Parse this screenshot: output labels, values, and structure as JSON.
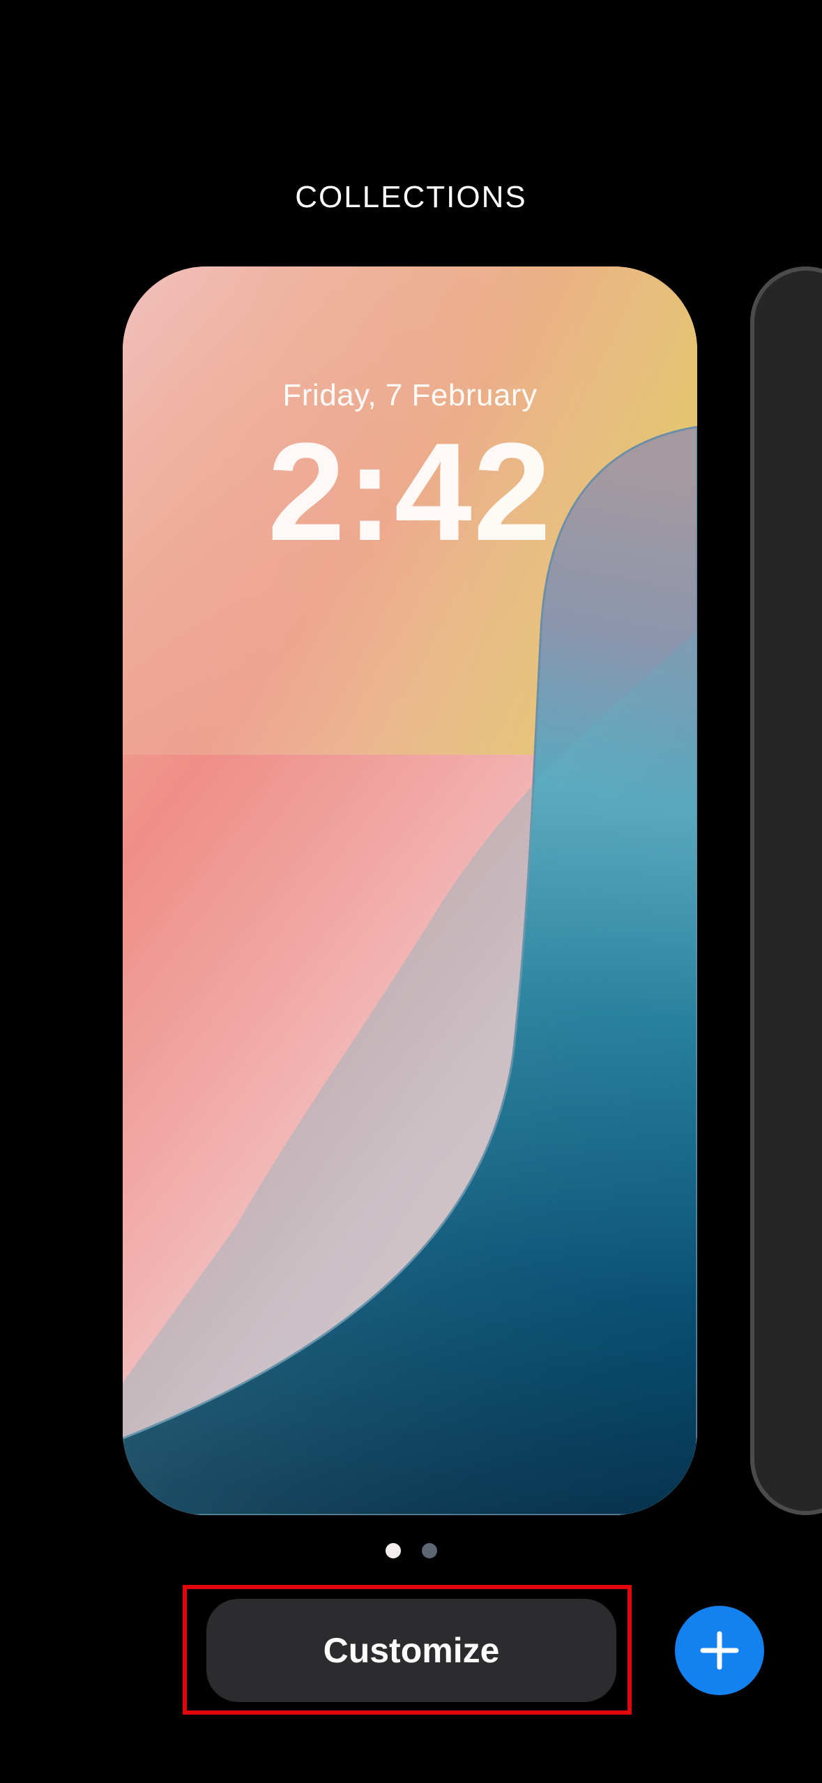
{
  "header": {
    "title": "COLLECTIONS"
  },
  "lock_screen": {
    "date": "Friday, 7 February",
    "time": "2:42"
  },
  "pager": {
    "page_count": 2,
    "current_page": 1
  },
  "actions": {
    "customize_label": "Customize",
    "add_icon": "plus-icon"
  },
  "colors": {
    "background": "#000000",
    "button_background": "#2c2c2e",
    "add_button": "#1382f0",
    "highlight": "#e1060b",
    "dot_active": "#f5eeee",
    "dot_inactive": "#5d6774"
  }
}
